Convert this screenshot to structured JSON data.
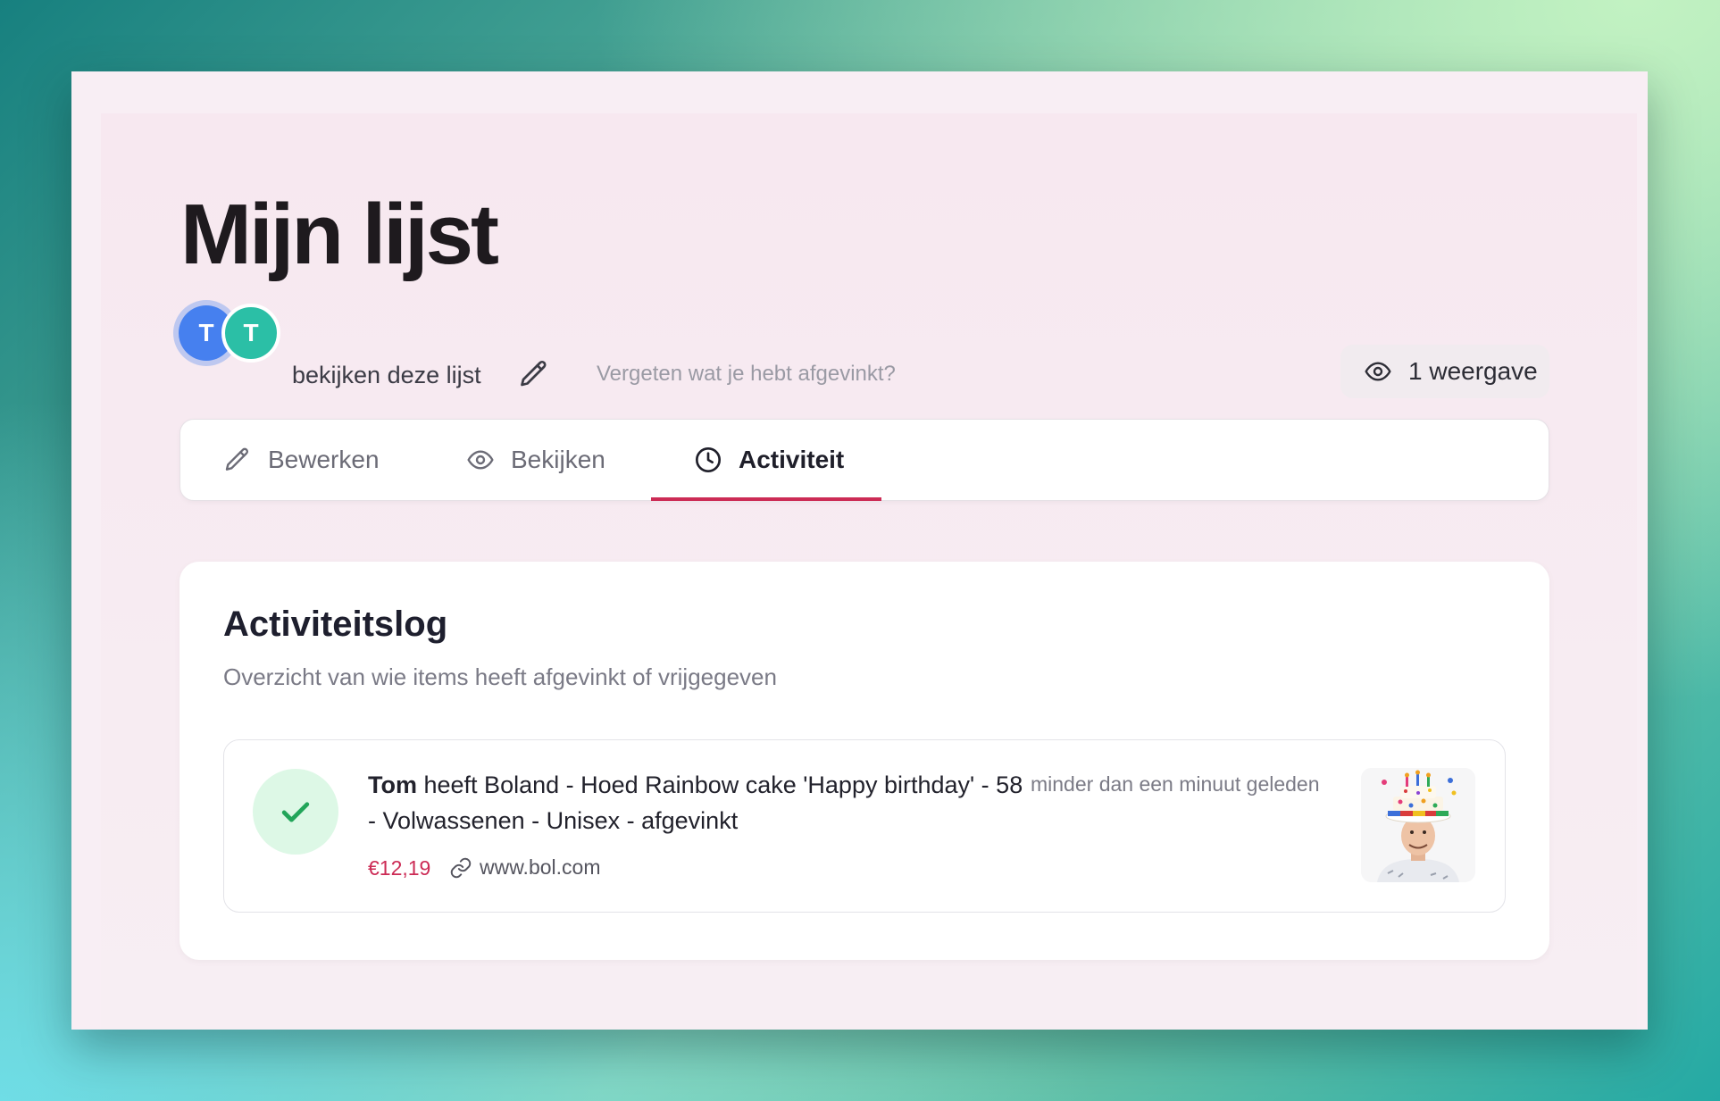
{
  "page": {
    "title": "Mijn lijst",
    "avatars": [
      "T",
      "T"
    ],
    "viewers_text": "bekijken deze lijst",
    "hint": "Vergeten wat je hebt afgevinkt?",
    "views": "1 weergave"
  },
  "tabs": [
    {
      "label": "Bewerken",
      "icon": "pencil-icon"
    },
    {
      "label": "Bekijken",
      "icon": "eye-icon"
    },
    {
      "label": "Activiteit",
      "icon": "clock-icon",
      "active": true
    }
  ],
  "activity": {
    "title": "Activiteitslog",
    "subtitle": "Overzicht van wie items heeft afgevinkt of vrijgegeven",
    "entries": [
      {
        "user": "Tom",
        "text": " heeft Boland - Hoed Rainbow cake 'Happy birthday' - 58 - Volwassenen - Unisex - afgevinkt",
        "time": "minder dan een minuut geleden",
        "price": "€12,19",
        "link": "www.bol.com"
      }
    ]
  },
  "colors": {
    "accent": "#cc2b55",
    "avatar_1": "#4680ef",
    "avatar_2": "#2bbfa6",
    "check_bg": "#ddf8e6",
    "check": "#22a55a"
  }
}
